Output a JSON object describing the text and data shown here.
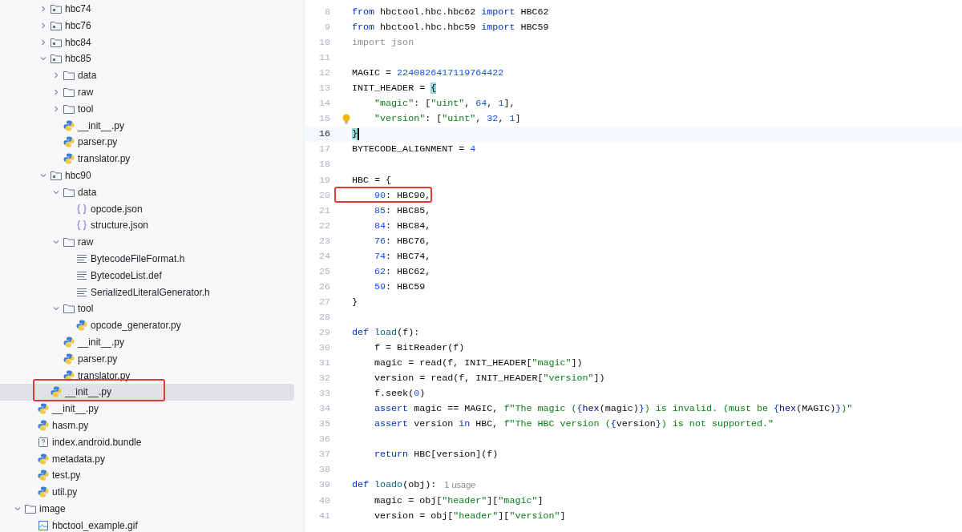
{
  "project_tree": [
    {
      "children": [
        {
          "children": [
            {
              "name": "hbc74",
              "kind": "package",
              "expanded": false,
              "selected": false,
              "annotated": false
            },
            {
              "name": "hbc76",
              "kind": "package",
              "expanded": false,
              "selected": false,
              "annotated": false
            },
            {
              "name": "hbc84",
              "kind": "package",
              "expanded": false,
              "selected": false,
              "annotated": false
            },
            {
              "name": "hbc85",
              "kind": "package",
              "expanded": true,
              "selected": false,
              "annotated": false,
              "children": [
                {
                  "name": "data",
                  "kind": "folder",
                  "expanded": false,
                  "selected": false,
                  "annotated": false
                },
                {
                  "name": "raw",
                  "kind": "folder",
                  "expanded": false,
                  "selected": false,
                  "annotated": false
                },
                {
                  "name": "tool",
                  "kind": "folder",
                  "expanded": false,
                  "selected": false,
                  "annotated": false
                },
                {
                  "name": "__init__.py",
                  "kind": "python",
                  "selected": false,
                  "annotated": false
                },
                {
                  "name": "parser.py",
                  "kind": "python",
                  "selected": false,
                  "annotated": false
                },
                {
                  "name": "translator.py",
                  "kind": "python",
                  "selected": false,
                  "annotated": false
                }
              ]
            },
            {
              "name": "hbc90",
              "kind": "package",
              "expanded": true,
              "selected": false,
              "annotated": false,
              "children": [
                {
                  "name": "data",
                  "kind": "folder",
                  "expanded": true,
                  "selected": false,
                  "annotated": false,
                  "children": [
                    {
                      "name": "opcode.json",
                      "kind": "json",
                      "selected": false,
                      "annotated": false
                    },
                    {
                      "name": "structure.json",
                      "kind": "json",
                      "selected": false,
                      "annotated": false
                    }
                  ]
                },
                {
                  "name": "raw",
                  "kind": "folder",
                  "expanded": true,
                  "selected": false,
                  "annotated": false,
                  "children": [
                    {
                      "name": "BytecodeFileFormat.h",
                      "kind": "text",
                      "selected": false,
                      "annotated": false
                    },
                    {
                      "name": "BytecodeList.def",
                      "kind": "text",
                      "selected": false,
                      "annotated": false
                    },
                    {
                      "name": "SerializedLiteralGenerator.h",
                      "kind": "text",
                      "selected": false,
                      "annotated": false
                    }
                  ]
                },
                {
                  "name": "tool",
                  "kind": "folder",
                  "expanded": true,
                  "selected": false,
                  "annotated": false,
                  "children": [
                    {
                      "name": "opcode_generator.py",
                      "kind": "python",
                      "selected": false,
                      "annotated": false
                    }
                  ]
                },
                {
                  "name": "__init__.py",
                  "kind": "python",
                  "selected": false,
                  "annotated": false
                },
                {
                  "name": "parser.py",
                  "kind": "python",
                  "selected": false,
                  "annotated": false
                },
                {
                  "name": "translator.py",
                  "kind": "python",
                  "selected": false,
                  "annotated": false
                }
              ]
            },
            {
              "name": "__init__.py",
              "kind": "python",
              "selected": true,
              "annotated": true
            }
          ]
        },
        {
          "name": "__init__.py",
          "kind": "python",
          "selected": false,
          "annotated": false
        },
        {
          "name": "hasm.py",
          "kind": "python",
          "selected": false,
          "annotated": false
        },
        {
          "name": "index.android.bundle",
          "kind": "unknown",
          "selected": false,
          "annotated": false
        },
        {
          "name": "metadata.py",
          "kind": "python",
          "selected": false,
          "annotated": false
        },
        {
          "name": "test.py",
          "kind": "python",
          "selected": false,
          "annotated": false
        },
        {
          "name": "util.py",
          "kind": "python",
          "selected": false,
          "annotated": false
        }
      ]
    },
    {
      "name": "image",
      "kind": "folder",
      "expanded": true,
      "selected": false,
      "annotated": false,
      "children": [
        {
          "name": "hbctool_example.gif",
          "kind": "image",
          "selected": false,
          "annotated": false
        }
      ]
    }
  ],
  "editor": {
    "lines": [
      {
        "number": "8",
        "current": false,
        "annotated": false,
        "indented": false,
        "bulb": false,
        "tokens": [
          {
            "text": "from",
            "kind": "keyword"
          },
          {
            "text": " hbctool.hbc.hbc62 "
          },
          {
            "text": "import",
            "kind": "keyword"
          },
          {
            "text": " HBC62"
          }
        ]
      },
      {
        "number": "9",
        "current": false,
        "annotated": false,
        "indented": false,
        "bulb": false,
        "tokens": [
          {
            "text": "from",
            "kind": "keyword"
          },
          {
            "text": " hbctool.hbc.hbc59 "
          },
          {
            "text": "import",
            "kind": "keyword"
          },
          {
            "text": " HBC59"
          }
        ]
      },
      {
        "number": "10",
        "current": false,
        "annotated": false,
        "indented": false,
        "bulb": false,
        "tokens": [
          {
            "text": "import json",
            "kind": "unused"
          }
        ]
      },
      {
        "number": "11",
        "current": false,
        "annotated": false,
        "bulb": false
      },
      {
        "number": "12",
        "current": false,
        "annotated": false,
        "indented": false,
        "bulb": false,
        "tokens": [
          {
            "text": "MAGIC = "
          },
          {
            "text": "2240826417119764422",
            "kind": "number"
          }
        ]
      },
      {
        "number": "13",
        "current": false,
        "annotated": false,
        "indented": false,
        "bulb": false,
        "tokens": [
          {
            "text": "INIT_HEADER = "
          },
          {
            "text": "{",
            "kind": "match"
          }
        ]
      },
      {
        "number": "14",
        "current": false,
        "annotated": false,
        "indented": true,
        "bulb": false,
        "tokens": [
          {
            "text": "\"magic\"",
            "kind": "string"
          },
          {
            "text": ": ["
          },
          {
            "text": "\"uint\"",
            "kind": "string"
          },
          {
            "text": ", "
          },
          {
            "text": "64",
            "kind": "number"
          },
          {
            "text": ", "
          },
          {
            "text": "1",
            "kind": "number"
          },
          {
            "text": "],"
          }
        ]
      },
      {
        "number": "15",
        "current": false,
        "annotated": false,
        "indented": true,
        "bulb": true,
        "tokens": [
          {
            "text": "\"version\"",
            "kind": "string"
          },
          {
            "text": ": ["
          },
          {
            "text": "\"uint\"",
            "kind": "string"
          },
          {
            "text": ", "
          },
          {
            "text": "32",
            "kind": "number"
          },
          {
            "text": ", "
          },
          {
            "text": "1",
            "kind": "number"
          },
          {
            "text": "]"
          }
        ]
      },
      {
        "number": "16",
        "current": true,
        "annotated": false,
        "indented": false,
        "bulb": false,
        "tokens": [
          {
            "text": "}",
            "kind": "match"
          }
        ]
      },
      {
        "number": "17",
        "current": false,
        "annotated": false,
        "indented": false,
        "bulb": false,
        "tokens": [
          {
            "text": "BYTECODE_ALIGNMENT = "
          },
          {
            "text": "4",
            "kind": "number"
          }
        ]
      },
      {
        "number": "18",
        "current": false,
        "annotated": false,
        "bulb": false
      },
      {
        "number": "19",
        "current": false,
        "annotated": false,
        "indented": false,
        "bulb": false,
        "tokens": [
          {
            "text": "HBC = {"
          }
        ]
      },
      {
        "number": "20",
        "current": false,
        "annotated": true,
        "indented": true,
        "bulb": false,
        "tokens": [
          {
            "text": "90",
            "kind": "number"
          },
          {
            "text": ": HBC90,"
          }
        ]
      },
      {
        "number": "21",
        "current": false,
        "annotated": false,
        "indented": true,
        "bulb": false,
        "tokens": [
          {
            "text": "85",
            "kind": "number"
          },
          {
            "text": ": HBC85,"
          }
        ]
      },
      {
        "number": "22",
        "current": false,
        "annotated": false,
        "indented": true,
        "bulb": false,
        "tokens": [
          {
            "text": "84",
            "kind": "number"
          },
          {
            "text": ": HBC84,"
          }
        ]
      },
      {
        "number": "23",
        "current": false,
        "annotated": false,
        "indented": true,
        "bulb": false,
        "tokens": [
          {
            "text": "76",
            "kind": "number"
          },
          {
            "text": ": HBC76,"
          }
        ]
      },
      {
        "number": "24",
        "current": false,
        "annotated": false,
        "indented": true,
        "bulb": false,
        "tokens": [
          {
            "text": "74",
            "kind": "number"
          },
          {
            "text": ": HBC74,"
          }
        ]
      },
      {
        "number": "25",
        "current": false,
        "annotated": false,
        "indented": true,
        "bulb": false,
        "tokens": [
          {
            "text": "62",
            "kind": "number"
          },
          {
            "text": ": HBC62,"
          }
        ]
      },
      {
        "number": "26",
        "current": false,
        "annotated": false,
        "indented": true,
        "bulb": false,
        "tokens": [
          {
            "text": "59",
            "kind": "number"
          },
          {
            "text": ": HBC59"
          }
        ]
      },
      {
        "number": "27",
        "current": false,
        "annotated": false,
        "indented": false,
        "bulb": false,
        "tokens": [
          {
            "text": "}"
          }
        ]
      },
      {
        "number": "28",
        "current": false,
        "annotated": false,
        "bulb": false
      },
      {
        "number": "29",
        "current": false,
        "annotated": false,
        "indented": false,
        "bulb": false,
        "tokens": [
          {
            "text": "def ",
            "kind": "keyword"
          },
          {
            "text": "load",
            "kind": "function"
          },
          {
            "text": "(f):"
          }
        ]
      },
      {
        "number": "30",
        "current": false,
        "annotated": false,
        "indented": true,
        "bulb": false,
        "tokens": [
          {
            "text": "f = BitReader(f)"
          }
        ]
      },
      {
        "number": "31",
        "current": false,
        "annotated": false,
        "indented": true,
        "bulb": false,
        "tokens": [
          {
            "text": "magic = read(f, INIT_HEADER["
          },
          {
            "text": "\"magic\"",
            "kind": "string"
          },
          {
            "text": "])"
          }
        ]
      },
      {
        "number": "32",
        "current": false,
        "annotated": false,
        "indented": true,
        "bulb": false,
        "tokens": [
          {
            "text": "version = read(f, INIT_HEADER["
          },
          {
            "text": "\"version\"",
            "kind": "string"
          },
          {
            "text": "])"
          }
        ]
      },
      {
        "number": "33",
        "current": false,
        "annotated": false,
        "indented": true,
        "bulb": false,
        "tokens": [
          {
            "text": "f.seek("
          },
          {
            "text": "0",
            "kind": "number"
          },
          {
            "text": ")"
          }
        ]
      },
      {
        "number": "34",
        "current": false,
        "annotated": false,
        "indented": true,
        "bulb": false,
        "tokens": [
          {
            "text": "assert",
            "kind": "keyword"
          },
          {
            "text": " magic == MAGIC, "
          },
          {
            "text": "f\"The magic (",
            "kind": "string"
          },
          {
            "text": "{",
            "kind": "brace"
          },
          {
            "text": "hex",
            "kind": "builtin"
          },
          {
            "text": "(magic)"
          },
          {
            "text": "}",
            "kind": "brace"
          },
          {
            "text": ") is invalid. (must be ",
            "kind": "string"
          },
          {
            "text": "{",
            "kind": "brace"
          },
          {
            "text": "hex",
            "kind": "builtin"
          },
          {
            "text": "(MAGIC)"
          },
          {
            "text": "}",
            "kind": "brace"
          },
          {
            "text": ")\"",
            "kind": "string"
          }
        ]
      },
      {
        "number": "35",
        "current": false,
        "annotated": false,
        "indented": true,
        "bulb": false,
        "tokens": [
          {
            "text": "assert",
            "kind": "keyword"
          },
          {
            "text": " version "
          },
          {
            "text": "in",
            "kind": "keyword"
          },
          {
            "text": " HBC, "
          },
          {
            "text": "f\"The HBC version (",
            "kind": "string"
          },
          {
            "text": "{",
            "kind": "brace"
          },
          {
            "text": "version"
          },
          {
            "text": "}",
            "kind": "brace"
          },
          {
            "text": ") is not supported.\"",
            "kind": "string"
          }
        ]
      },
      {
        "number": "36",
        "current": false,
        "annotated": false,
        "bulb": false
      },
      {
        "number": "37",
        "current": false,
        "annotated": false,
        "indented": true,
        "bulb": false,
        "tokens": [
          {
            "text": "return",
            "kind": "keyword"
          },
          {
            "text": " HBC[version](f)"
          }
        ]
      },
      {
        "number": "38",
        "current": false,
        "annotated": false,
        "bulb": false
      },
      {
        "number": "39",
        "current": false,
        "annotated": false,
        "indented": false,
        "bulb": false,
        "hint": "1 usage",
        "tokens": [
          {
            "text": "def ",
            "kind": "keyword"
          },
          {
            "text": "loado",
            "kind": "function"
          },
          {
            "text": "(obj):"
          }
        ]
      },
      {
        "number": "40",
        "current": false,
        "annotated": false,
        "indented": true,
        "bulb": false,
        "tokens": [
          {
            "text": "magic = obj["
          },
          {
            "text": "\"header\"",
            "kind": "string"
          },
          {
            "text": "]["
          },
          {
            "text": "\"magic\"",
            "kind": "string"
          },
          {
            "text": "]"
          }
        ]
      },
      {
        "number": "41",
        "current": false,
        "annotated": false,
        "indented": true,
        "bulb": false,
        "tokens": [
          {
            "text": "version = obj["
          },
          {
            "text": "\"header\"",
            "kind": "string"
          },
          {
            "text": "]["
          },
          {
            "text": "\"version\"",
            "kind": "string"
          },
          {
            "text": "]"
          }
        ]
      }
    ]
  }
}
